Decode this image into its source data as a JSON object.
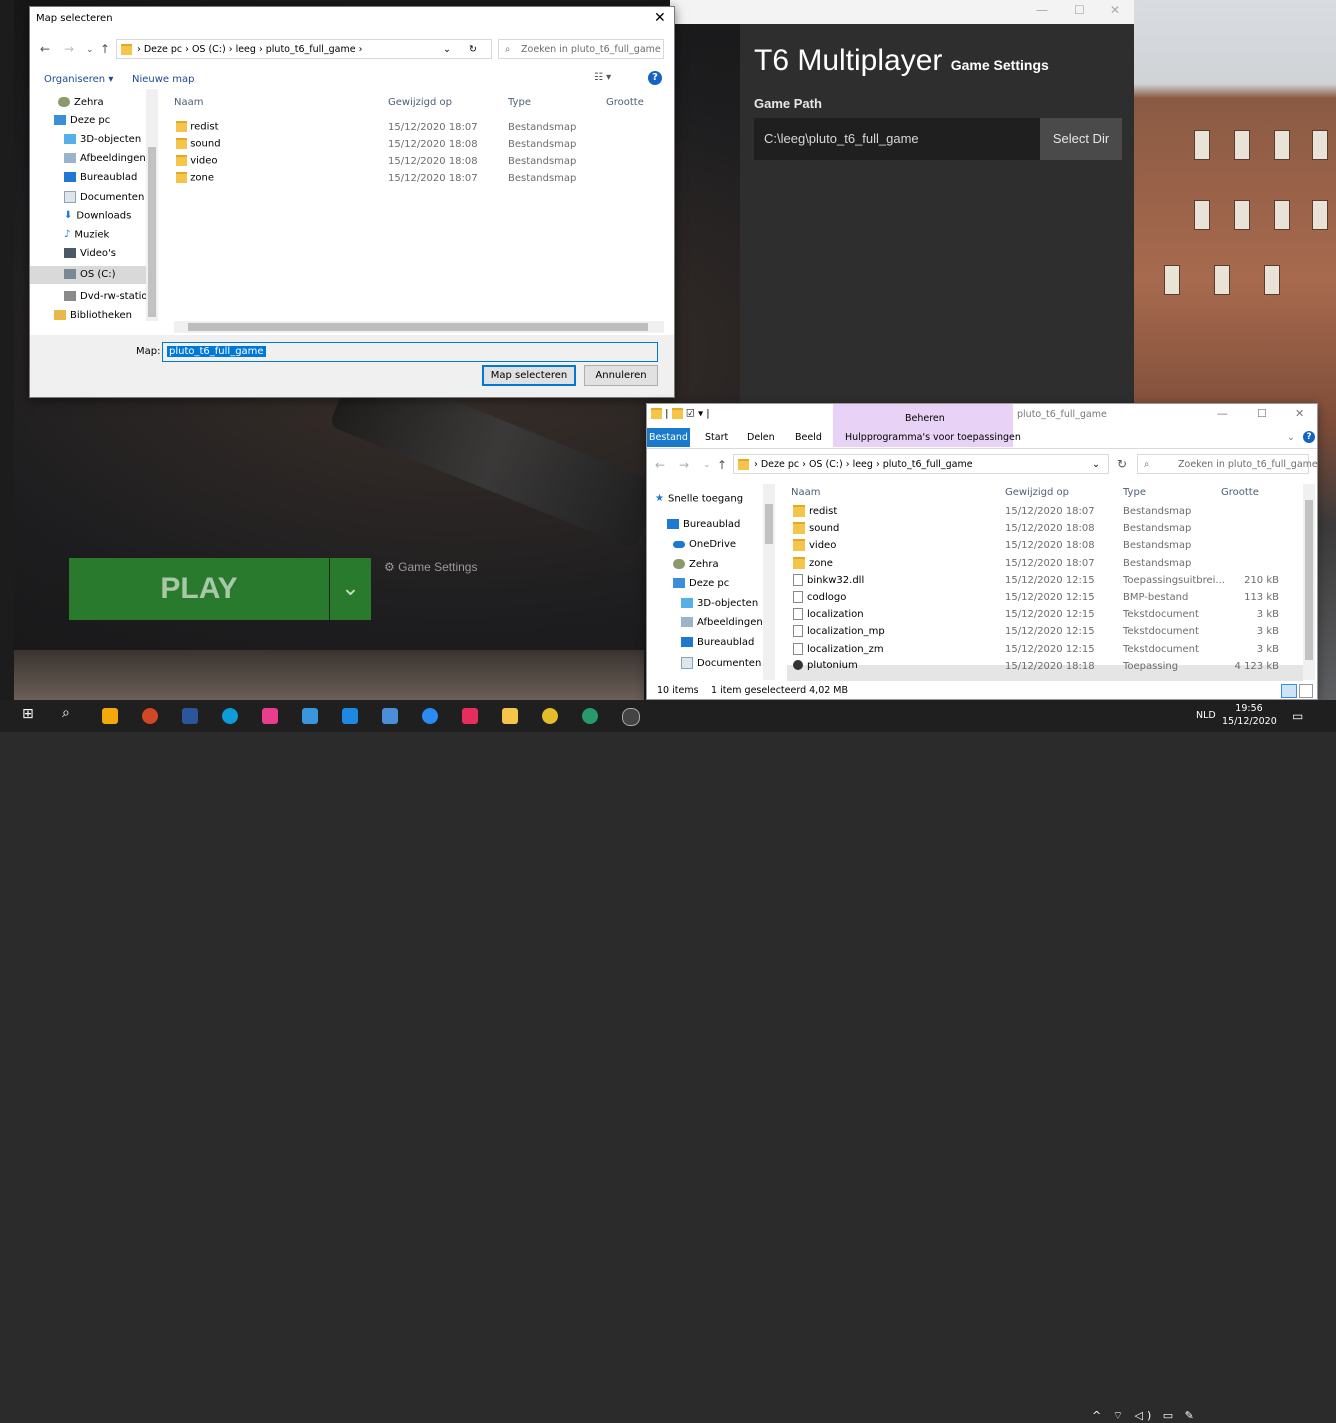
{
  "launcher": {
    "title": "T6 Multiplayer",
    "subtitle": "Game Settings",
    "game_path_label": "Game Path",
    "game_path_value": "C:\\leeg\\pluto_t6_full_game",
    "select_dir_label": "Select Dir",
    "play_label": "PLAY",
    "game_settings_link": "Game Settings"
  },
  "dialog": {
    "title": "Map selecteren",
    "breadcrumb": [
      "Deze pc",
      "OS (C:)",
      "leeg",
      "pluto_t6_full_game"
    ],
    "search_placeholder": "Zoeken in pluto_t6_full_game",
    "organize_label": "Organiseren ▾",
    "new_folder_label": "Nieuwe map",
    "nav_tree": [
      "Zehra",
      "Deze pc",
      "3D-objecten",
      "Afbeeldingen",
      "Bureaublad",
      "Documenten",
      "Downloads",
      "Muziek",
      "Video's",
      "OS (C:)",
      "Dvd-rw-station",
      "Bibliotheken"
    ],
    "columns": [
      "Naam",
      "Gewijzigd op",
      "Type",
      "Grootte"
    ],
    "rows": [
      {
        "name": "redist",
        "modified": "15/12/2020 18:07",
        "type": "Bestandsmap"
      },
      {
        "name": "sound",
        "modified": "15/12/2020 18:08",
        "type": "Bestandsmap"
      },
      {
        "name": "video",
        "modified": "15/12/2020 18:08",
        "type": "Bestandsmap"
      },
      {
        "name": "zone",
        "modified": "15/12/2020 18:07",
        "type": "Bestandsmap"
      }
    ],
    "map_label": "Map:",
    "map_value": "pluto_t6_full_game",
    "select_button": "Map selecteren",
    "cancel_button": "Annuleren"
  },
  "explorer": {
    "window_title": "pluto_t6_full_game",
    "ribbon_context": "Beheren",
    "ribbon_context_tab": "Hulpprogramma's voor toepassingen",
    "tabs": [
      "Bestand",
      "Start",
      "Delen",
      "Beeld"
    ],
    "breadcrumb": [
      "Deze pc",
      "OS (C:)",
      "leeg",
      "pluto_t6_full_game"
    ],
    "search_placeholder": "Zoeken in pluto_t6_full_game",
    "nav_tree": [
      "Snelle toegang",
      "Bureaublad",
      "OneDrive",
      "Zehra",
      "Deze pc",
      "3D-objecten",
      "Afbeeldingen",
      "Bureaublad",
      "Documenten"
    ],
    "columns": [
      "Naam",
      "Gewijzigd op",
      "Type",
      "Grootte"
    ],
    "rows": [
      {
        "name": "redist",
        "modified": "15/12/2020 18:07",
        "type": "Bestandsmap",
        "size": ""
      },
      {
        "name": "sound",
        "modified": "15/12/2020 18:08",
        "type": "Bestandsmap",
        "size": ""
      },
      {
        "name": "video",
        "modified": "15/12/2020 18:08",
        "type": "Bestandsmap",
        "size": ""
      },
      {
        "name": "zone",
        "modified": "15/12/2020 18:07",
        "type": "Bestandsmap",
        "size": ""
      },
      {
        "name": "binkw32.dll",
        "modified": "15/12/2020 12:15",
        "type": "Toepassingsuitbrei...",
        "size": "210 kB"
      },
      {
        "name": "codlogo",
        "modified": "15/12/2020 12:15",
        "type": "BMP-bestand",
        "size": "113 kB"
      },
      {
        "name": "localization",
        "modified": "15/12/2020 12:15",
        "type": "Tekstdocument",
        "size": "3 kB"
      },
      {
        "name": "localization_mp",
        "modified": "15/12/2020 12:15",
        "type": "Tekstdocument",
        "size": "3 kB"
      },
      {
        "name": "localization_zm",
        "modified": "15/12/2020 12:15",
        "type": "Tekstdocument",
        "size": "3 kB"
      },
      {
        "name": "plutonium",
        "modified": "15/12/2020 18:18",
        "type": "Toepassing",
        "size": "4 123 kB"
      }
    ],
    "status_items": "10 items",
    "status_selected": "1 item geselecteerd 4,02 MB"
  },
  "taskbar": {
    "language": "NLD",
    "time": "19:56",
    "date": "15/12/2020"
  },
  "colors": {
    "accent": "#0078d7",
    "play_green": "#2a7a2e",
    "ribbon_purple": "#e8d2f5"
  }
}
